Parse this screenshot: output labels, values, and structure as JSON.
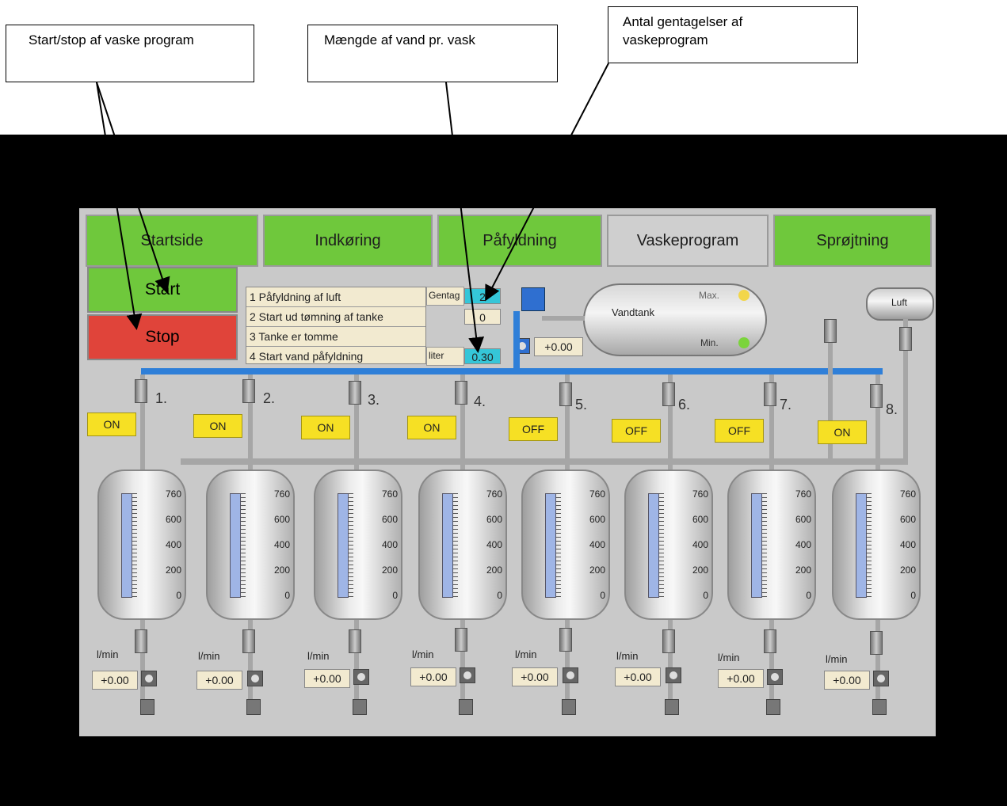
{
  "callouts": {
    "start_stop": "Start/stop af vaske program",
    "water_amount": "Mængde af vand pr. vask",
    "repetitions": "Antal gentagelser af vaskeprogram"
  },
  "tabs": [
    "Startside",
    "Indkøring",
    "Påfyldning",
    "Vaskeprogram",
    "Sprøjtning"
  ],
  "active_tab": "Vaskeprogram",
  "buttons": {
    "start": "Start",
    "stop": "Stop"
  },
  "steps": [
    "1 Påfyldning af luft",
    "2 Start ud tømning af tanke",
    "3 Tanke er tomme",
    "4 Start vand påfyldning"
  ],
  "gentag": {
    "label": "Gentag",
    "value": "2"
  },
  "counter": "0",
  "liter": {
    "label": "liter",
    "value": "0.30"
  },
  "main_flow": "+0.00",
  "vandtank": {
    "label": "Vandtank",
    "max": "Max.",
    "min": "Min."
  },
  "luft": "Luft",
  "valves": [
    {
      "num": "1.",
      "state": "ON"
    },
    {
      "num": "2.",
      "state": "ON"
    },
    {
      "num": "3.",
      "state": "ON"
    },
    {
      "num": "4.",
      "state": "ON"
    },
    {
      "num": "5.",
      "state": "OFF"
    },
    {
      "num": "6.",
      "state": "OFF"
    },
    {
      "num": "7.",
      "state": "OFF"
    },
    {
      "num": "8.",
      "state": "ON"
    }
  ],
  "scale_labels": [
    "760",
    "600",
    "400",
    "200",
    "0"
  ],
  "flow_unit": "l/min",
  "flows": [
    "+0.00",
    "+0.00",
    "+0.00",
    "+0.00",
    "+0.00",
    "+0.00",
    "+0.00",
    "+0.00"
  ],
  "colors": {
    "tab_green": "#6fc83c",
    "stop_red": "#e0443a",
    "on_yellow": "#f6e024",
    "cyan": "#35c6d8",
    "pipe_blue": "#2f7fd8"
  }
}
